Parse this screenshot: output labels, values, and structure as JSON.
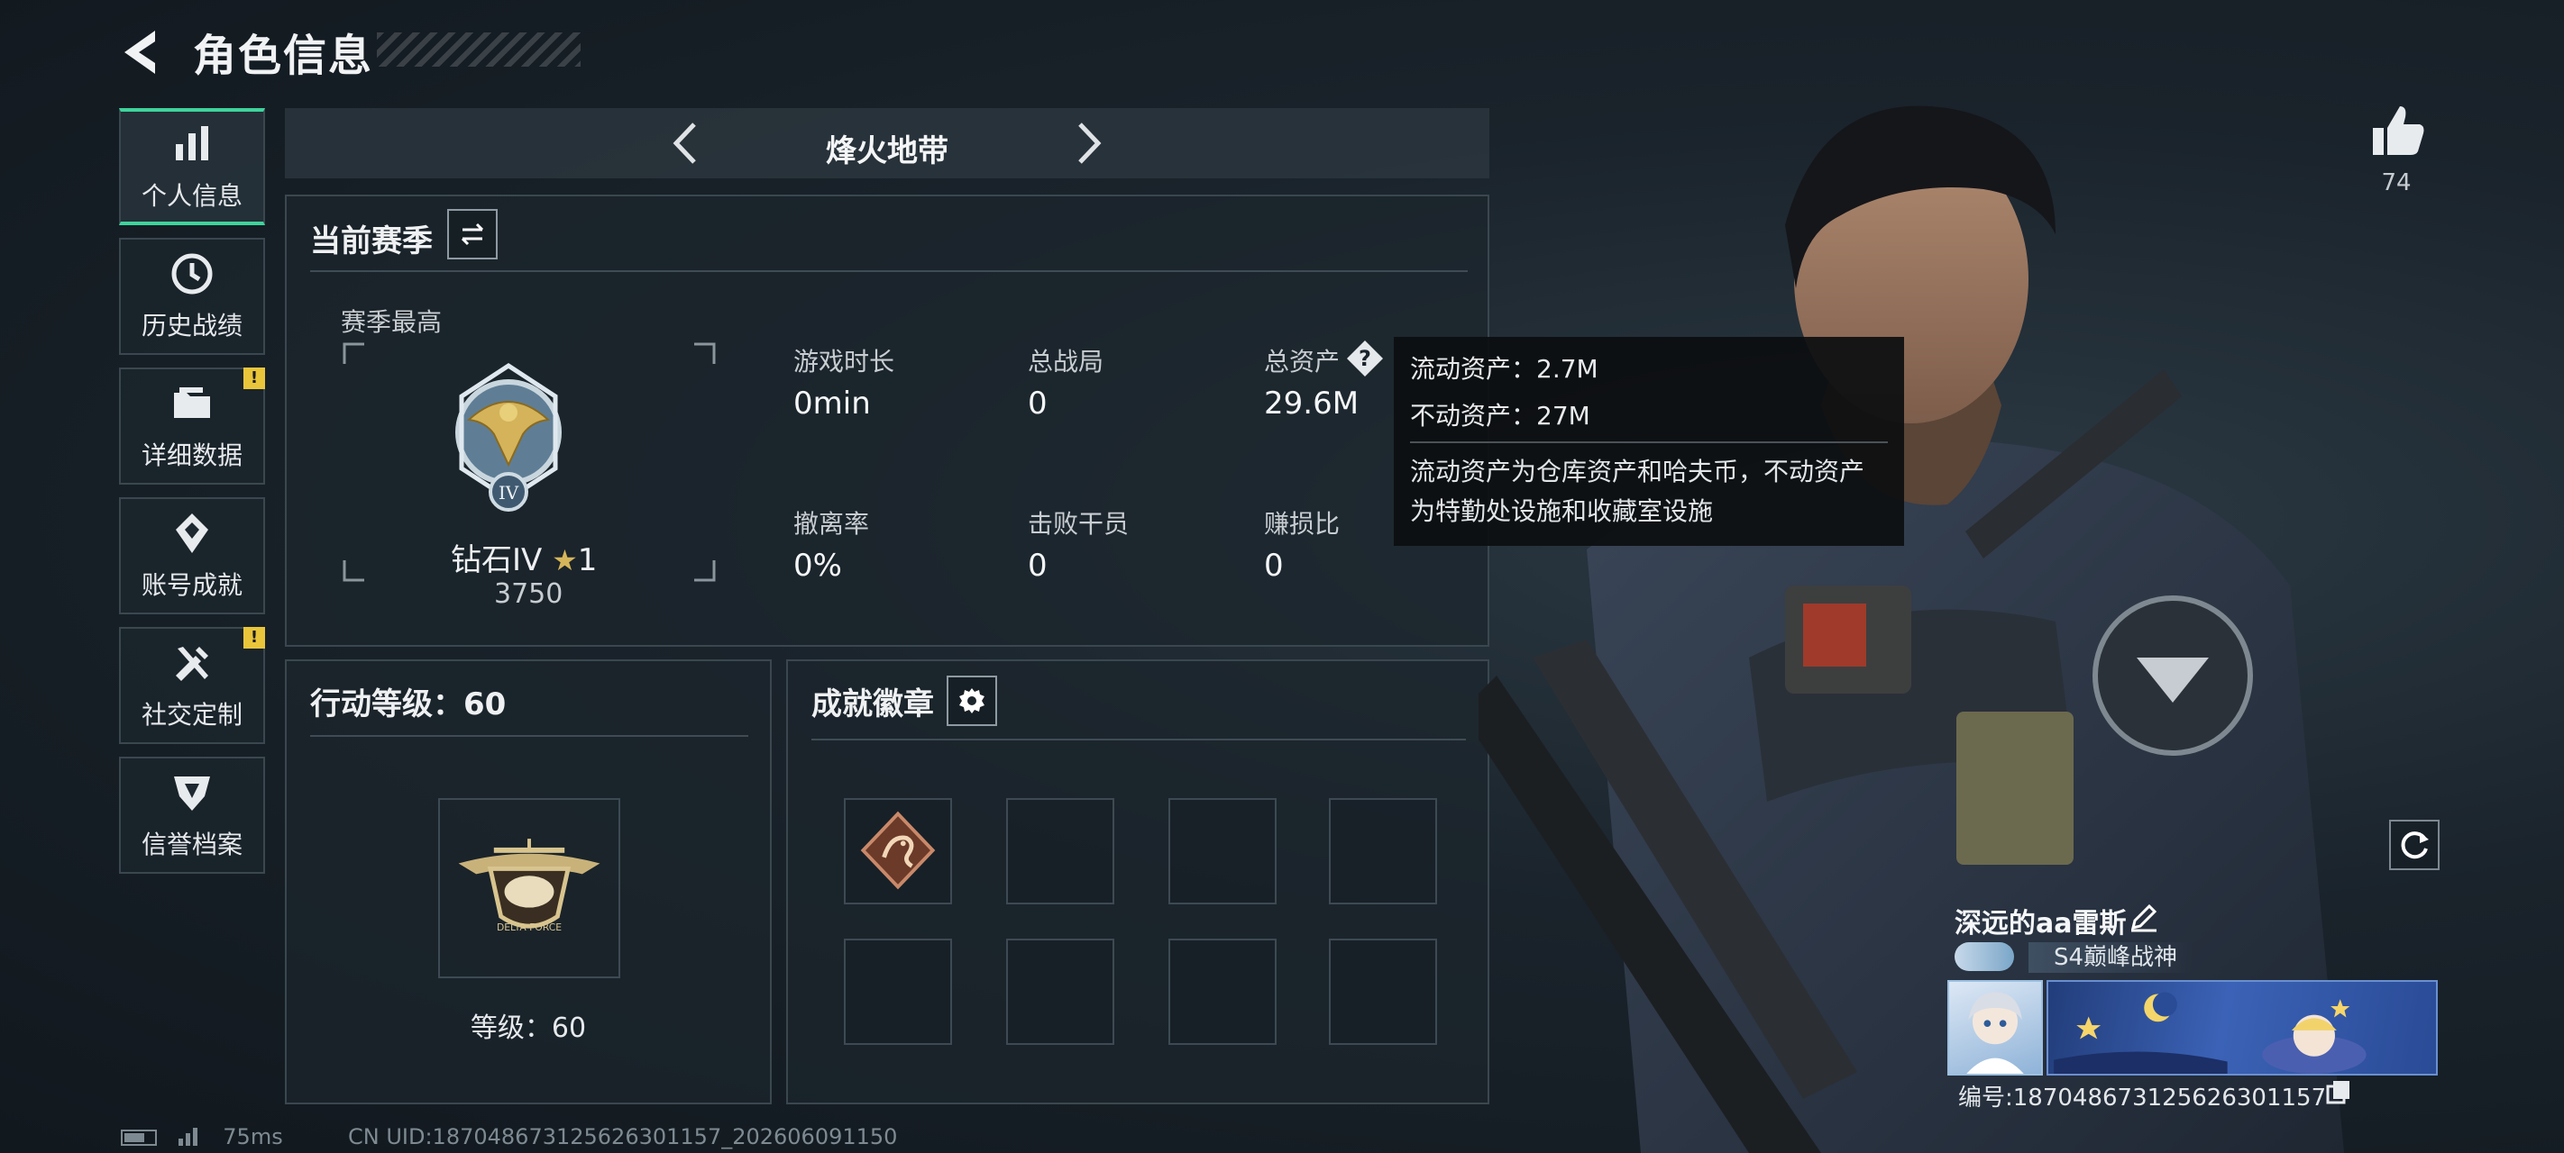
{
  "header": {
    "title": "角色信息"
  },
  "nav": [
    {
      "label": "个人信息",
      "icon": "bar-chart-icon",
      "active": true,
      "badge": ""
    },
    {
      "label": "历史战绩",
      "icon": "clock-icon",
      "active": false,
      "badge": ""
    },
    {
      "label": "详细数据",
      "icon": "folder-icon",
      "active": false,
      "badge": "!"
    },
    {
      "label": "账号成就",
      "icon": "achievement-icon",
      "active": false,
      "badge": ""
    },
    {
      "label": "社交定制",
      "icon": "tools-icon",
      "active": false,
      "badge": "!"
    },
    {
      "label": "信誉档案",
      "icon": "shield-icon",
      "active": false,
      "badge": ""
    }
  ],
  "season_nav": {
    "title": "烽火地带"
  },
  "season": {
    "title": "当前赛季",
    "best_label": "赛季最高",
    "rank": "钻石IV",
    "rank_stars": "1",
    "rank_points": "3750",
    "rank_badge_numeral": "IV",
    "stats": [
      {
        "label": "游戏时长",
        "value": "0min"
      },
      {
        "label": "总战局",
        "value": "0"
      },
      {
        "label": "总资产",
        "value": "29.6M"
      },
      {
        "label": "撤离率",
        "value": "0%"
      },
      {
        "label": "击败干员",
        "value": "0"
      },
      {
        "label": "赚损比",
        "value": "0"
      }
    ]
  },
  "tooltip": {
    "liquid": "流动资产：2.7M",
    "fixed": "不动资产：27M",
    "description": "流动资产为仓库资产和哈夫币，不动资产为特勤处设施和收藏室设施"
  },
  "action_level": {
    "title": "行动等级：60",
    "level_text": "等级：60",
    "emblem_text": "DELTA FORCE"
  },
  "achievement_badges": {
    "title": "成就徽章",
    "slots": 8,
    "filled": 1
  },
  "right": {
    "like_count": "74",
    "player_name": "深远的aa雷斯",
    "player_title": "S4巅峰战神",
    "card_id": "编号:187048673125626301157"
  },
  "status": {
    "latency": "75ms",
    "uid": "CN UID:187048673125626301157_202606091150"
  },
  "colors": {
    "accent": "#3fd49d",
    "badge": "#e8c53a",
    "panel_border": "#3a474f"
  }
}
